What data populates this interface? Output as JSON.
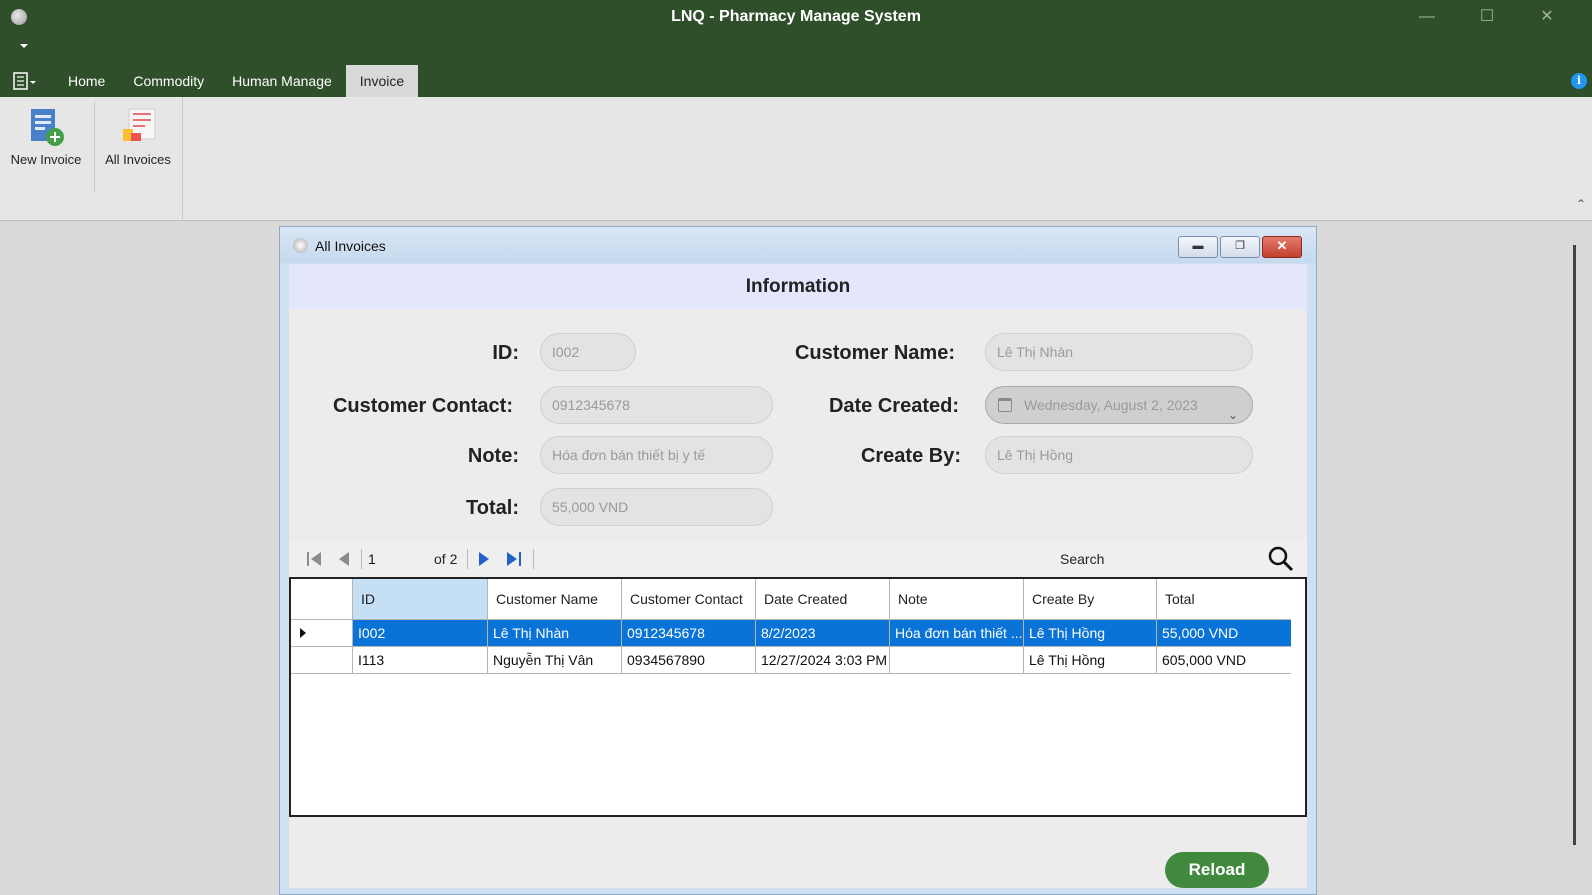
{
  "window": {
    "title": "LNQ - Pharmacy Manage System"
  },
  "tabs": [
    "Home",
    "Commodity",
    "Human Manage",
    "Invoice"
  ],
  "active_tab": "Invoice",
  "ribbon": {
    "new_invoice": "New Invoice",
    "all_invoices": "All Invoices"
  },
  "child": {
    "title": "All Invoices",
    "header": "Information",
    "labels": {
      "id": "ID:",
      "customer_name": "Customer Name:",
      "customer_contact": "Customer Contact:",
      "date_created": "Date Created:",
      "note": "Note:",
      "create_by": "Create By:",
      "total": "Total:"
    },
    "values": {
      "id": "I002",
      "customer_name": "Lê Thị Nhàn",
      "customer_contact": "0912345678",
      "date_created": "Wednesday, August 2, 2023",
      "note": "Hóa đơn bán thiết bị y tế",
      "create_by": "Lê Thị Hồng",
      "total": "55,000 VND"
    },
    "navigator": {
      "position": "1",
      "count": "of 2",
      "search_label": "Search"
    },
    "grid": {
      "columns": [
        "ID",
        "Customer Name",
        "Customer Contact",
        "Date Created",
        "Note",
        "Create By",
        "Total"
      ],
      "rows": [
        [
          "I002",
          "Lê Thị Nhàn",
          "0912345678",
          "8/2/2023",
          "Hóa đơn bán thiết ...",
          "Lê Thị Hồng",
          "55,000 VND"
        ],
        [
          "I113",
          "Nguyễn Thị Vân",
          "0934567890",
          "12/27/2024 3:03 PM",
          "",
          "Lê Thị Hồng",
          "605,000 VND"
        ]
      ]
    },
    "reload_label": "Reload"
  },
  "colors": {
    "titlebar": "#2f4f2a",
    "selection": "#0a73d8",
    "reload": "#41893e",
    "info_header": "#e4e7fb"
  }
}
